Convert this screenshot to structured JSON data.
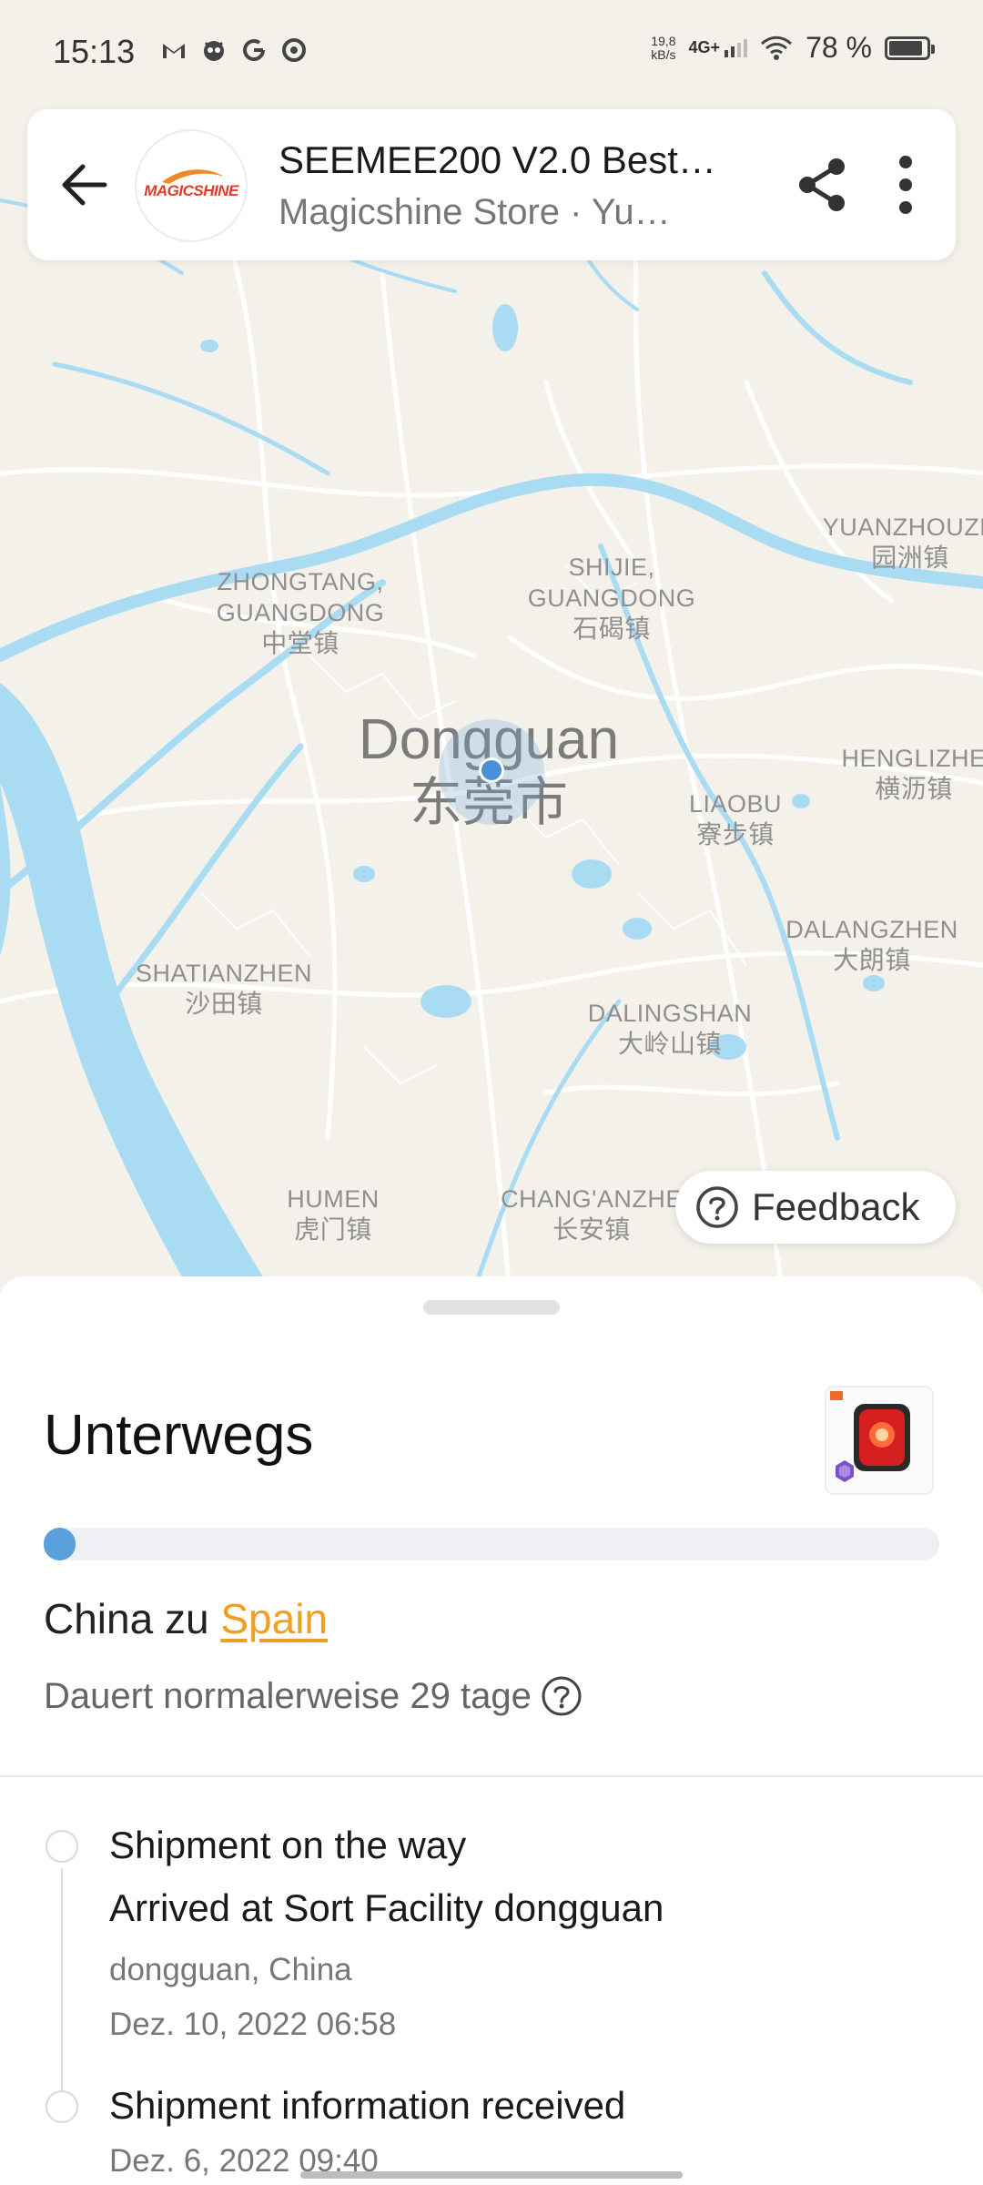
{
  "status_bar": {
    "time": "15:13",
    "app_icons": [
      "gmail-icon",
      "mascot-icon",
      "google-icon",
      "chrome-icon"
    ],
    "net_speed": "19,8",
    "net_unit": "kB/s",
    "network": "4G+",
    "battery": "78 %",
    "battery_level": 0.78
  },
  "header": {
    "title": "SEEMEE200 V2.0 Best…",
    "subtitle": "Magicshine Store  ·  Yu…",
    "logo_text": "MAGICSHINE"
  },
  "map": {
    "city_en": "Dongguan",
    "city_cn": "东莞市",
    "places": [
      {
        "en": "ZHONGTANG,",
        "en2": "GUANGDONG",
        "cn": "中堂镇"
      },
      {
        "en": "SHIJIE,",
        "en2": "GUANGDONG",
        "cn": "石碣镇"
      },
      {
        "en": "YUANZHOUZH",
        "en2": "",
        "cn": "园洲镇"
      },
      {
        "en": "HENGLIZHE",
        "en2": "",
        "cn": "横沥镇"
      },
      {
        "en": "LIAOBU",
        "en2": "",
        "cn": "寮步镇"
      },
      {
        "en": "DALANGZHEN",
        "en2": "",
        "cn": "大朗镇"
      },
      {
        "en": "SHATIANZHEN",
        "en2": "",
        "cn": "沙田镇"
      },
      {
        "en": "DALINGSHAN",
        "en2": "",
        "cn": "大岭山镇"
      },
      {
        "en": "HUMEN",
        "en2": "",
        "cn": "虎门镇"
      },
      {
        "en": "CHANG'ANZHE",
        "en2": "",
        "cn": "长安镇"
      }
    ]
  },
  "feedback": {
    "label": "Feedback"
  },
  "tracking": {
    "status": "Unterwegs",
    "progress": 0.035,
    "route_prefix": "China zu ",
    "destination": "Spain",
    "duration": "Dauert normalerweise 29 tage",
    "events": [
      {
        "title": "Shipment on the way",
        "detail": "Arrived at Sort Facility dongguan",
        "location": "dongguan, China",
        "time": "Dez. 10, 2022 06:58"
      },
      {
        "title": "Shipment information received",
        "time": "Dez. 6, 2022 09:40"
      }
    ]
  },
  "colors": {
    "accent_orange": "#f0a020",
    "progress_blue": "#5aa0dc",
    "water": "#a9dcf3",
    "land": "#f3f1ea"
  }
}
